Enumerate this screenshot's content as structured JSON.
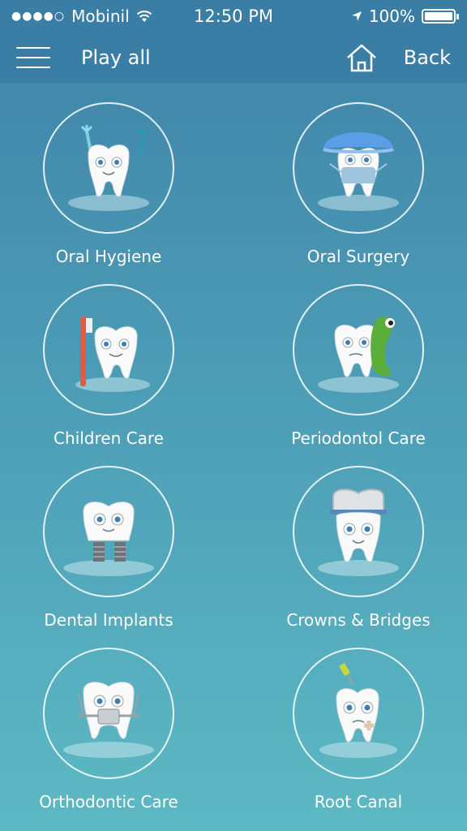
{
  "status_bar": {
    "carrier": "Mobinil",
    "time": "12:50 PM",
    "battery": "100%"
  },
  "nav": {
    "play_all": "Play all",
    "back": "Back"
  },
  "categories": [
    {
      "label": "Oral Hygiene",
      "icon": "tooth-floss-icon"
    },
    {
      "label": "Oral Surgery",
      "icon": "tooth-surgeon-icon"
    },
    {
      "label": "Children Care",
      "icon": "tooth-toothbrush-icon"
    },
    {
      "label": "Periodontol Care",
      "icon": "tooth-germ-icon"
    },
    {
      "label": "Dental Implants",
      "icon": "tooth-implant-icon"
    },
    {
      "label": "Crowns & Bridges",
      "icon": "tooth-crown-icon"
    },
    {
      "label": "Orthodontic Care",
      "icon": "tooth-braces-icon"
    },
    {
      "label": "Root Canal",
      "icon": "tooth-root-canal-icon"
    }
  ]
}
